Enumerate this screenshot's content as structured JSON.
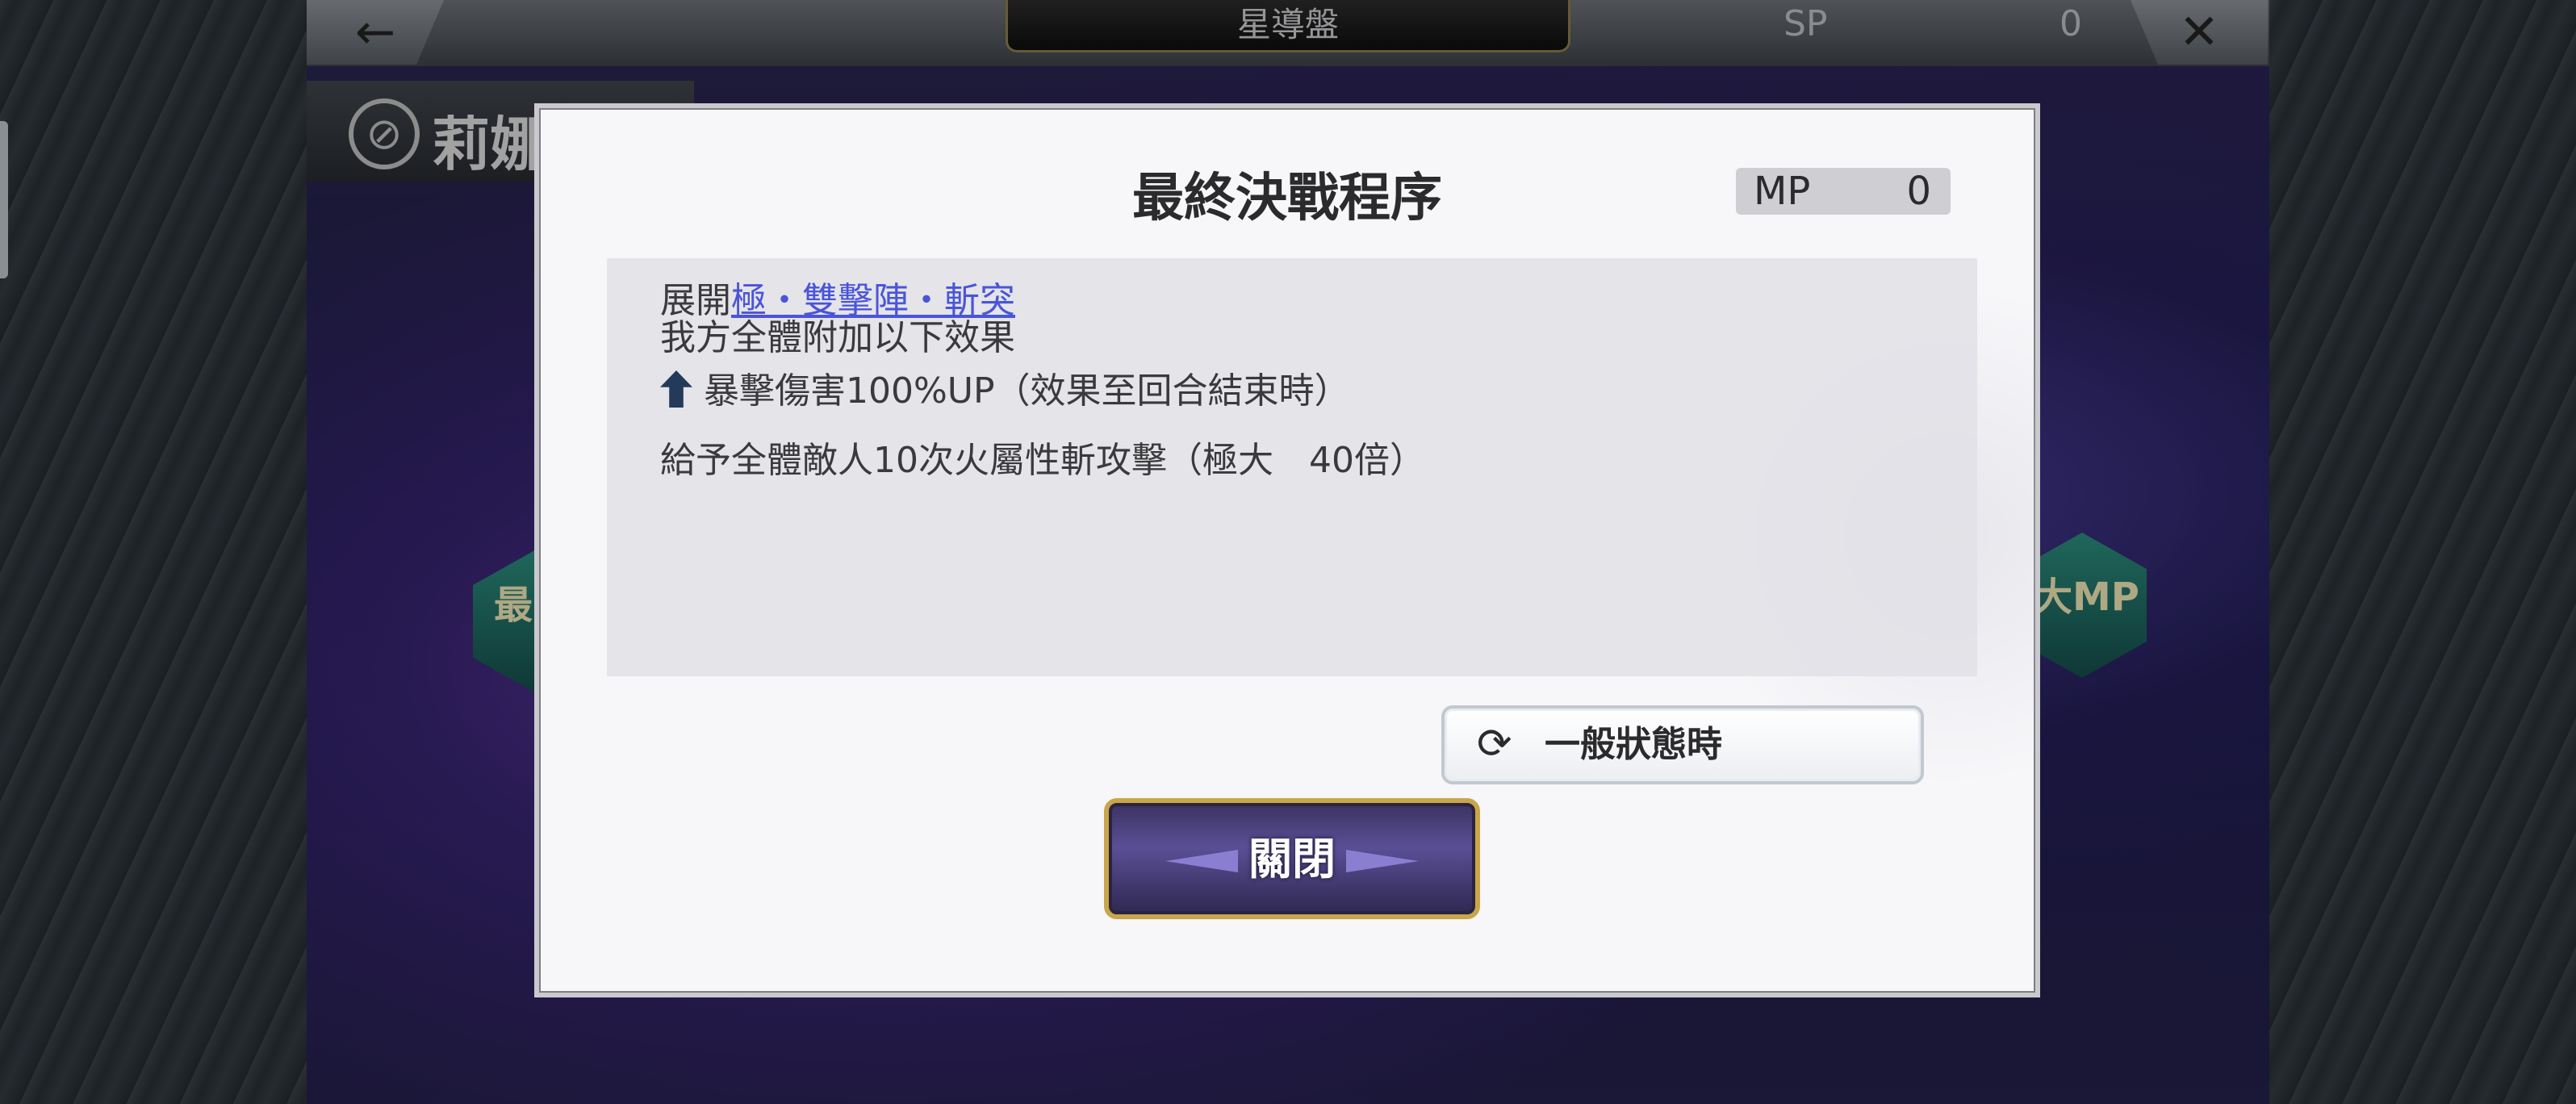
{
  "header": {
    "back_icon": "back-arrow-icon",
    "screen_title": "星導盤",
    "sp_label": "SP",
    "sp_value": "0",
    "close_icon": "close-x-icon"
  },
  "character": {
    "name": "莉娜"
  },
  "background_nodes": {
    "left_text": "最",
    "right_text": "大MP"
  },
  "modal": {
    "title": "最終決戰程序",
    "mp_label": "MP",
    "mp_value": "0",
    "description": {
      "line1_prefix": "展開",
      "line1_link": "極・雙擊陣・斬突",
      "line2": "我方全體附加以下效果",
      "line3": "暴擊傷害100%UP（效果至回合結束時）",
      "line3_icon": "up-arrow-icon",
      "line4": "給予全體敵人10次火屬性斬攻擊（極大　40倍）"
    },
    "state_button": {
      "icon": "refresh-icon",
      "label": "一般狀態時"
    },
    "close_button_label": "關閉"
  },
  "colors": {
    "link": "#4a55d8",
    "close_button_border": "#c9a64a",
    "close_button_fill": "#5a4f96"
  }
}
